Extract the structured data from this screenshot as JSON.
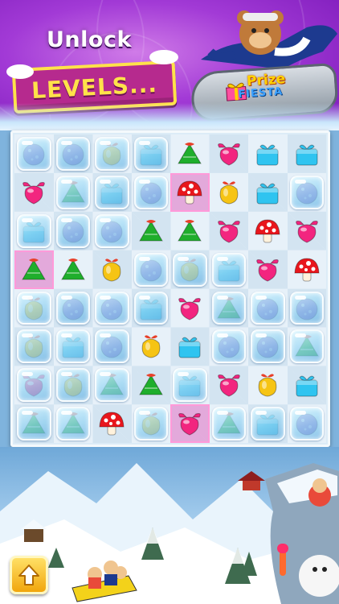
{
  "banner": {
    "unlock_text": "Unlock",
    "levels_text": "LEVELS...",
    "logo_top": "Prize",
    "logo_bottom": "FIESTA"
  },
  "board": {
    "rows": 8,
    "cols": 8,
    "cells": [
      [
        "ice:ornament",
        "ice:ornament",
        "ice:bell",
        "ice:gift",
        "tree",
        "candy",
        "gift",
        "gift"
      ],
      [
        "candy",
        "ice:tree",
        "ice:gift",
        "ice:ornament",
        "hl:mushroom",
        "bell",
        "gift",
        "ice:ornament"
      ],
      [
        "ice:gift",
        "ice:ornament",
        "ice:ornament",
        "tree",
        "tree",
        "candy",
        "mushroom",
        "candy"
      ],
      [
        "hl:tree",
        "tree",
        "bell",
        "ice:ornament",
        "ice:bell",
        "ice:gift",
        "candy",
        "mushroom"
      ],
      [
        "ice:bell",
        "ice:ornament",
        "ice:ornament",
        "ice:gift",
        "candy",
        "ice:tree",
        "ice:ornament",
        "ice:ornament"
      ],
      [
        "ice:bell",
        "ice:gift",
        "ice:ornament",
        "bell",
        "gift",
        "ice:ornament",
        "ice:ornament",
        "ice:tree"
      ],
      [
        "ice:candy",
        "ice:bell",
        "ice:tree",
        "tree",
        "ice:gift",
        "candy",
        "bell",
        "gift"
      ],
      [
        "ice:tree",
        "ice:tree",
        "mushroom",
        "ice:bell",
        "hl:candy",
        "ice:tree",
        "ice:gift",
        "ice:ornament"
      ]
    ]
  },
  "colors": {
    "candy": "#f2257f",
    "tree": "#1fae2c",
    "gift": "#2fc4f0",
    "bell": "#f6c414",
    "mushroom": "#e8161c",
    "ornament": "#8a6acb",
    "banner_purple": "#a23ad6",
    "highlight": "#ff9ad9"
  },
  "controls": {
    "up_button_icon": "up-arrow-icon"
  }
}
